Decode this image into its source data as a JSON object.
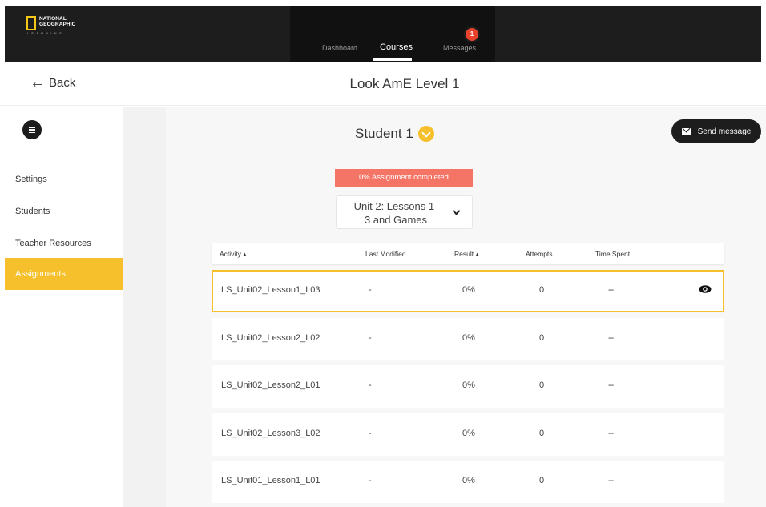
{
  "brand": {
    "logo_line1": "NATIONAL",
    "logo_line2": "GEOGRAPHIC",
    "logo_sub": "LEARNING"
  },
  "nav": {
    "items": [
      {
        "label": "Dashboard"
      },
      {
        "label": "Courses"
      },
      {
        "label": "Messages"
      }
    ],
    "active": "Courses",
    "messages_badge": "1"
  },
  "header": {
    "back_label": "Back",
    "course_title": "Look AmE Level 1"
  },
  "sidebar": {
    "items": [
      {
        "label": "Settings"
      },
      {
        "label": "Students"
      },
      {
        "label": "Teacher Resources"
      },
      {
        "label": "Assignments"
      }
    ],
    "active": "Assignments"
  },
  "main": {
    "student": "Student 1",
    "send_message": "Send message",
    "progress": "0% Assignment completed",
    "unit_line1": "Unit 2: Lessons 1-",
    "unit_line2": "3 and Games"
  },
  "table": {
    "headers": {
      "activity": "Activity ▴",
      "last_modified": "Last Modified",
      "result": "Result ▴",
      "attempts": "Attempts",
      "time_spent": "Time Spent"
    },
    "rows": [
      {
        "activity": "LS_Unit02_Lesson1_L03",
        "last_modified": "-",
        "result": "0%",
        "attempts": "0",
        "time_spent": "--"
      },
      {
        "activity": "LS_Unit02_Lesson2_L02",
        "last_modified": "-",
        "result": "0%",
        "attempts": "0",
        "time_spent": "--"
      },
      {
        "activity": "LS_Unit02_Lesson2_L01",
        "last_modified": "-",
        "result": "0%",
        "attempts": "0",
        "time_spent": "--"
      },
      {
        "activity": "LS_Unit02_Lesson3_L02",
        "last_modified": "-",
        "result": "0%",
        "attempts": "0",
        "time_spent": "--"
      },
      {
        "activity": "LS_Unit01_Lesson1_L01",
        "last_modified": "-",
        "result": "0%",
        "attempts": "0",
        "time_spent": "--"
      }
    ]
  },
  "colors": {
    "accent": "#f5c02b",
    "topbar": "#1d1d1d",
    "progress": "#f47466",
    "badge": "#e8412c"
  }
}
